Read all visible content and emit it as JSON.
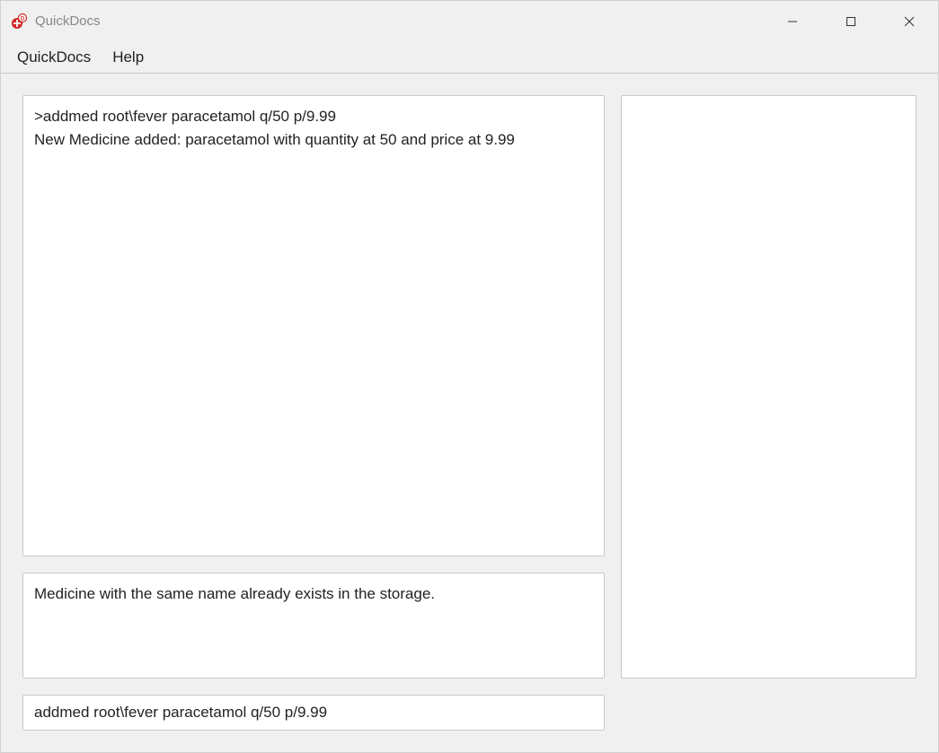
{
  "window": {
    "title": "QuickDocs"
  },
  "menubar": {
    "items": [
      {
        "label": "QuickDocs"
      },
      {
        "label": "Help"
      }
    ]
  },
  "log": {
    "text": ">addmed root\\fever paracetamol q/50 p/9.99\nNew Medicine added: paracetamol with quantity at 50 and price at 9.99"
  },
  "message": {
    "text": "Medicine with the same name already exists in the storage."
  },
  "command": {
    "value": "addmed root\\fever paracetamol q/50 p/9.99"
  },
  "sidepanel": {
    "text": ""
  }
}
